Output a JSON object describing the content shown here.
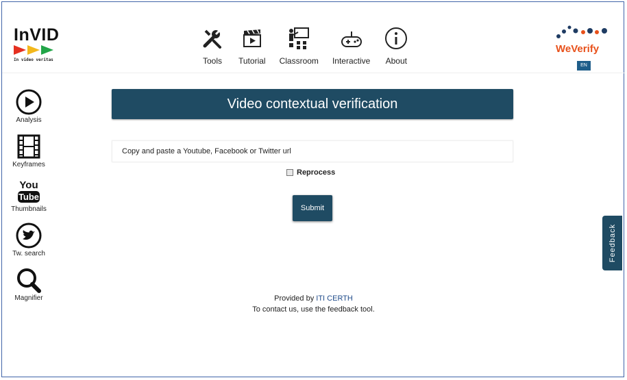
{
  "header": {
    "logo": {
      "title": "InVID",
      "tagline": "In video veritas"
    },
    "nav": [
      {
        "label": "Tools",
        "icon": "tools-icon"
      },
      {
        "label": "Tutorial",
        "icon": "clapperboard-icon"
      },
      {
        "label": "Classroom",
        "icon": "classroom-icon"
      },
      {
        "label": "Interactive",
        "icon": "gamepad-icon"
      },
      {
        "label": "About",
        "icon": "info-icon"
      }
    ],
    "partner_logo": "WeVerify",
    "language": "EN"
  },
  "sidebar": {
    "items": [
      {
        "label": "Analysis",
        "icon": "play-circle-icon"
      },
      {
        "label": "Keyframes",
        "icon": "film-icon"
      },
      {
        "label": "Thumbnails",
        "icon": "youtube-icon"
      },
      {
        "label": "Tw. search",
        "icon": "twitter-icon"
      },
      {
        "label": "Magnifier",
        "icon": "magnifier-icon"
      }
    ]
  },
  "main": {
    "title": "Video contextual verification",
    "url_placeholder": "Copy and paste a Youtube, Facebook or Twitter url",
    "reprocess_label": "Reprocess",
    "reprocess_checked": false,
    "submit_label": "Submit"
  },
  "footer": {
    "provided_by": "Provided by ",
    "provider": "ITI CERTH",
    "contact": "To contact us, use the feedback tool."
  },
  "feedback_tab": "Feedback",
  "colors": {
    "primary": "#1f4b63",
    "brand_orange": "#e8511b",
    "logo_red": "#e53020",
    "logo_yellow": "#f3b81c",
    "logo_green": "#22a548"
  }
}
